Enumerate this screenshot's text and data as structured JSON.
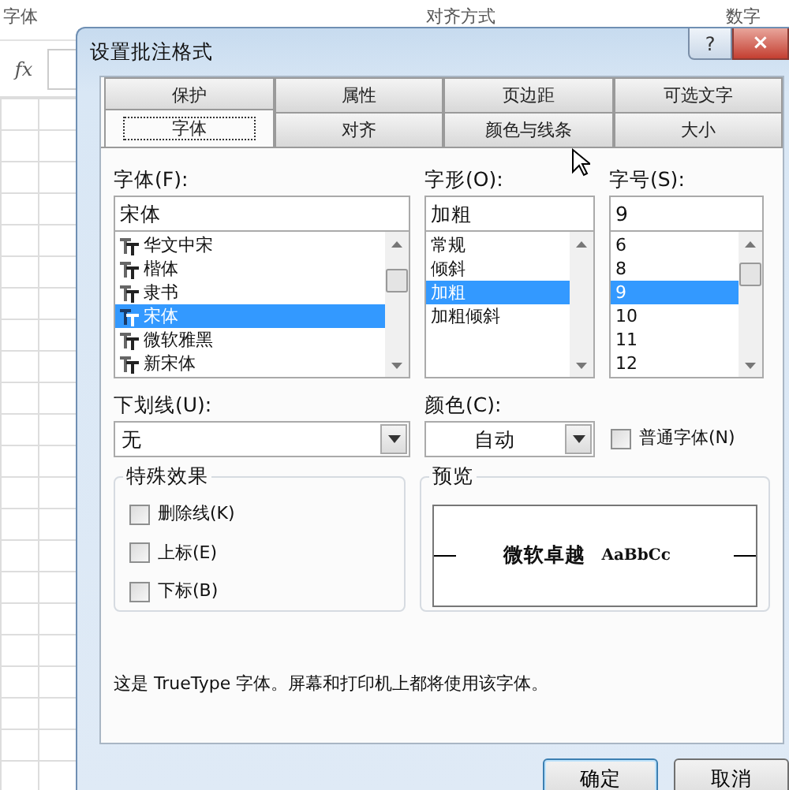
{
  "sheet": {
    "ribbon_groups": [
      "字体",
      "对齐方式",
      "数字"
    ],
    "formula_label": "fx"
  },
  "dialog": {
    "title": "设置批注格式",
    "help": "?",
    "close": "×"
  },
  "tab_rows": [
    {
      "tabs": [
        {
          "label": "保护",
          "selected": false
        },
        {
          "label": "属性",
          "selected": false
        },
        {
          "label": "页边距",
          "selected": false
        },
        {
          "label": "可选文字",
          "selected": false
        }
      ]
    },
    {
      "tabs": [
        {
          "label": "字体",
          "selected": true
        },
        {
          "label": "对齐",
          "selected": false
        },
        {
          "label": "颜色与线条",
          "selected": false
        },
        {
          "label": "大小",
          "selected": false
        }
      ]
    }
  ],
  "font": {
    "label": "字体(F):",
    "value": "宋体",
    "items": [
      {
        "label": "华文中宋",
        "selected": false
      },
      {
        "label": "楷体",
        "selected": false
      },
      {
        "label": "隶书",
        "selected": false
      },
      {
        "label": "宋体",
        "selected": true
      },
      {
        "label": "微软雅黑",
        "selected": false
      },
      {
        "label": "新宋体",
        "selected": false
      }
    ]
  },
  "style": {
    "label": "字形(O):",
    "value": "加粗",
    "items": [
      {
        "label": "常规",
        "selected": false
      },
      {
        "label": "倾斜",
        "selected": false
      },
      {
        "label": "加粗",
        "selected": true
      },
      {
        "label": "加粗倾斜",
        "selected": false
      }
    ]
  },
  "size": {
    "label": "字号(S):",
    "value": "9",
    "items": [
      {
        "label": "6",
        "selected": false
      },
      {
        "label": "8",
        "selected": false
      },
      {
        "label": "9",
        "selected": true
      },
      {
        "label": "10",
        "selected": false
      },
      {
        "label": "11",
        "selected": false
      },
      {
        "label": "12",
        "selected": false
      }
    ]
  },
  "underline": {
    "label": "下划线(U):",
    "value": "无"
  },
  "color": {
    "label": "颜色(C):",
    "value": "自动"
  },
  "normal_font": {
    "label": "普通字体(N)",
    "checked": false
  },
  "effects": {
    "title": "特殊效果",
    "options": [
      {
        "label": "删除线(K)",
        "checked": false
      },
      {
        "label": "上标(E)",
        "checked": false
      },
      {
        "label": "下标(B)",
        "checked": false
      }
    ]
  },
  "preview": {
    "title": "预览",
    "sample_cjk": "微软卓越",
    "sample_latin": "AaBbCc"
  },
  "note": "这是 TrueType 字体。屏幕和打印机上都将使用该字体。",
  "buttons": [
    "确定",
    "取消"
  ]
}
